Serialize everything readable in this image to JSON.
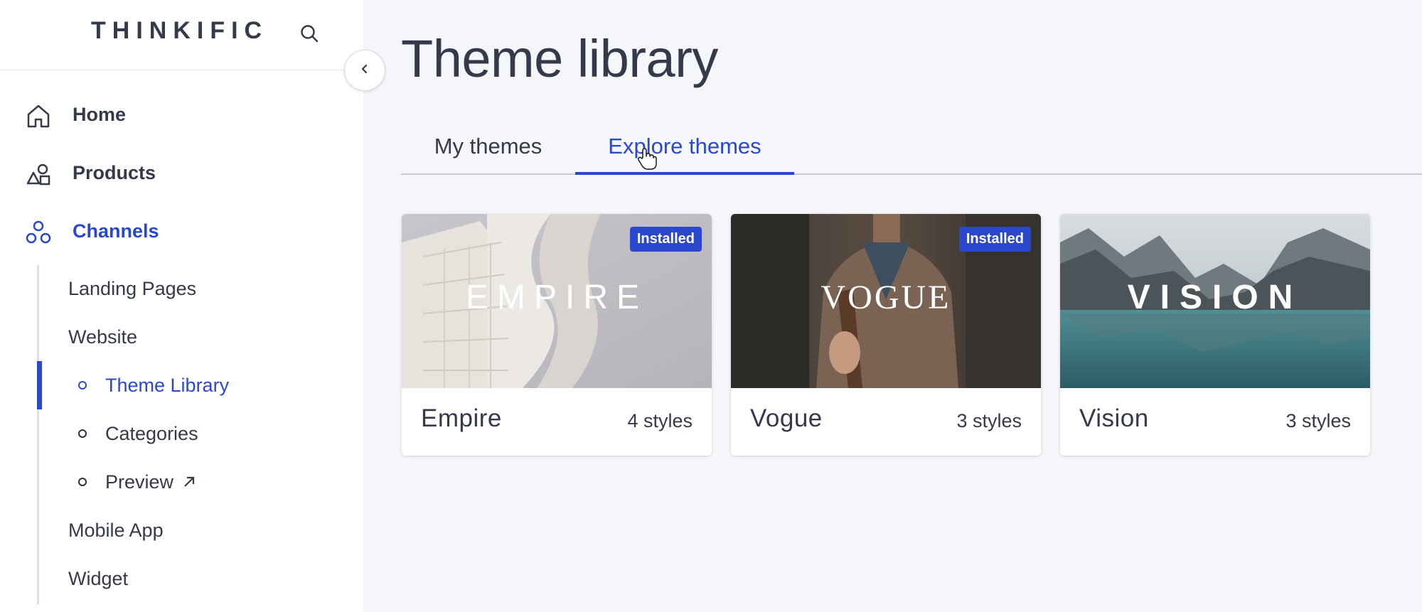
{
  "sidebar": {
    "logo": "THINKIFIC",
    "nav": [
      {
        "label": "Home",
        "icon": "home-icon"
      },
      {
        "label": "Products",
        "icon": "shapes-icon"
      },
      {
        "label": "Channels",
        "icon": "channels-icon"
      }
    ],
    "channels_sub": [
      {
        "label": "Landing Pages"
      },
      {
        "label": "Website"
      }
    ],
    "website_sub": [
      {
        "label": "Theme Library"
      },
      {
        "label": "Categories"
      },
      {
        "label": "Preview"
      }
    ],
    "channels_sub_after": [
      {
        "label": "Mobile App"
      },
      {
        "label": "Widget"
      }
    ]
  },
  "page": {
    "title": "Theme library",
    "tabs": [
      {
        "label": "My themes"
      },
      {
        "label": "Explore themes"
      }
    ],
    "active_tab": "Explore themes"
  },
  "themes": [
    {
      "name": "Empire",
      "styles": "4 styles",
      "thumb_text": "EMPIRE",
      "badge": "Installed"
    },
    {
      "name": "Vogue",
      "styles": "3 styles",
      "thumb_text": "VOGUE",
      "badge": "Installed"
    },
    {
      "name": "Vision",
      "styles": "3 styles",
      "thumb_text": "VISION"
    }
  ],
  "colors": {
    "accent": "#2b48cc",
    "text": "#353a4a",
    "background": "#f5f6fa"
  }
}
